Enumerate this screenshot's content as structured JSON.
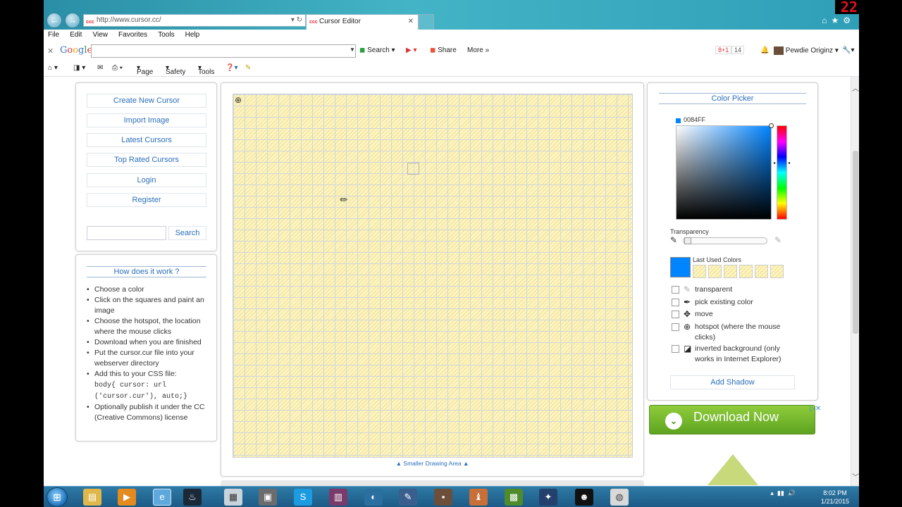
{
  "browser": {
    "url": "http://www.cursor.cc/",
    "tab_title": "Cursor Editor",
    "favicon": "ccc",
    "menu": [
      "File",
      "Edit",
      "View",
      "Favorites",
      "Tools",
      "Help"
    ]
  },
  "googlebar": {
    "close": "✕",
    "logo": "Google",
    "search_label": "Search",
    "share_label": "Share",
    "more_label": "More",
    "plusone": "8+1",
    "plusone_count": "14",
    "profile_name": "Pewdie Originz"
  },
  "commandbar": {
    "page_label": "Page",
    "safety_label": "Safety",
    "tools_label": "Tools"
  },
  "sidebar": {
    "nav": [
      {
        "label": "Create New Cursor"
      },
      {
        "label": "Import Image"
      },
      {
        "label": "Latest Cursors"
      },
      {
        "label": "Top Rated Cursors"
      },
      {
        "label": "Login"
      },
      {
        "label": "Register"
      }
    ],
    "search_button": "Search",
    "search_value": ""
  },
  "howto": {
    "title": "How does it work ?",
    "steps": [
      "Choose a color",
      "Click on the squares and paint an image",
      "Choose the hotspot, the location where the mouse clicks",
      "Download when you are finished",
      "Put the cursor.cur file into your webserver directory",
      "Add this to your CSS file:",
      "Optionally publish it under the CC (Creative Commons) license"
    ],
    "css_code": "body{ cursor: url ('cursor.cur'), auto;}"
  },
  "drawing": {
    "hotspot_icon": "⊕",
    "smaller_link": "▲ Smaller Drawing Area ▲"
  },
  "color_picker": {
    "title": "Color Picker",
    "current_hex": "0084FF",
    "current_color": "#0084ff",
    "transparency_label": "Transparency",
    "transparency_value": 0,
    "last_used_label": "Last Used Colors",
    "last_used_main": "#0084ff",
    "options": [
      {
        "label": "transparent",
        "icon": "eraser-icon"
      },
      {
        "label": "pick existing color",
        "icon": "eyedropper-icon"
      },
      {
        "label": "move",
        "icon": "move-icon"
      },
      {
        "label": "hotspot (where the mouse clicks)",
        "icon": "hotspot-icon"
      },
      {
        "label": "inverted background (only works in Internet Explorer)",
        "icon": "invert-icon"
      }
    ],
    "add_shadow": "Add Shadow"
  },
  "ad": {
    "label": "Download Now"
  },
  "overlay": {
    "counter": "22"
  },
  "taskbar": {
    "time": "8:02 PM",
    "date": "1/21/2015"
  }
}
